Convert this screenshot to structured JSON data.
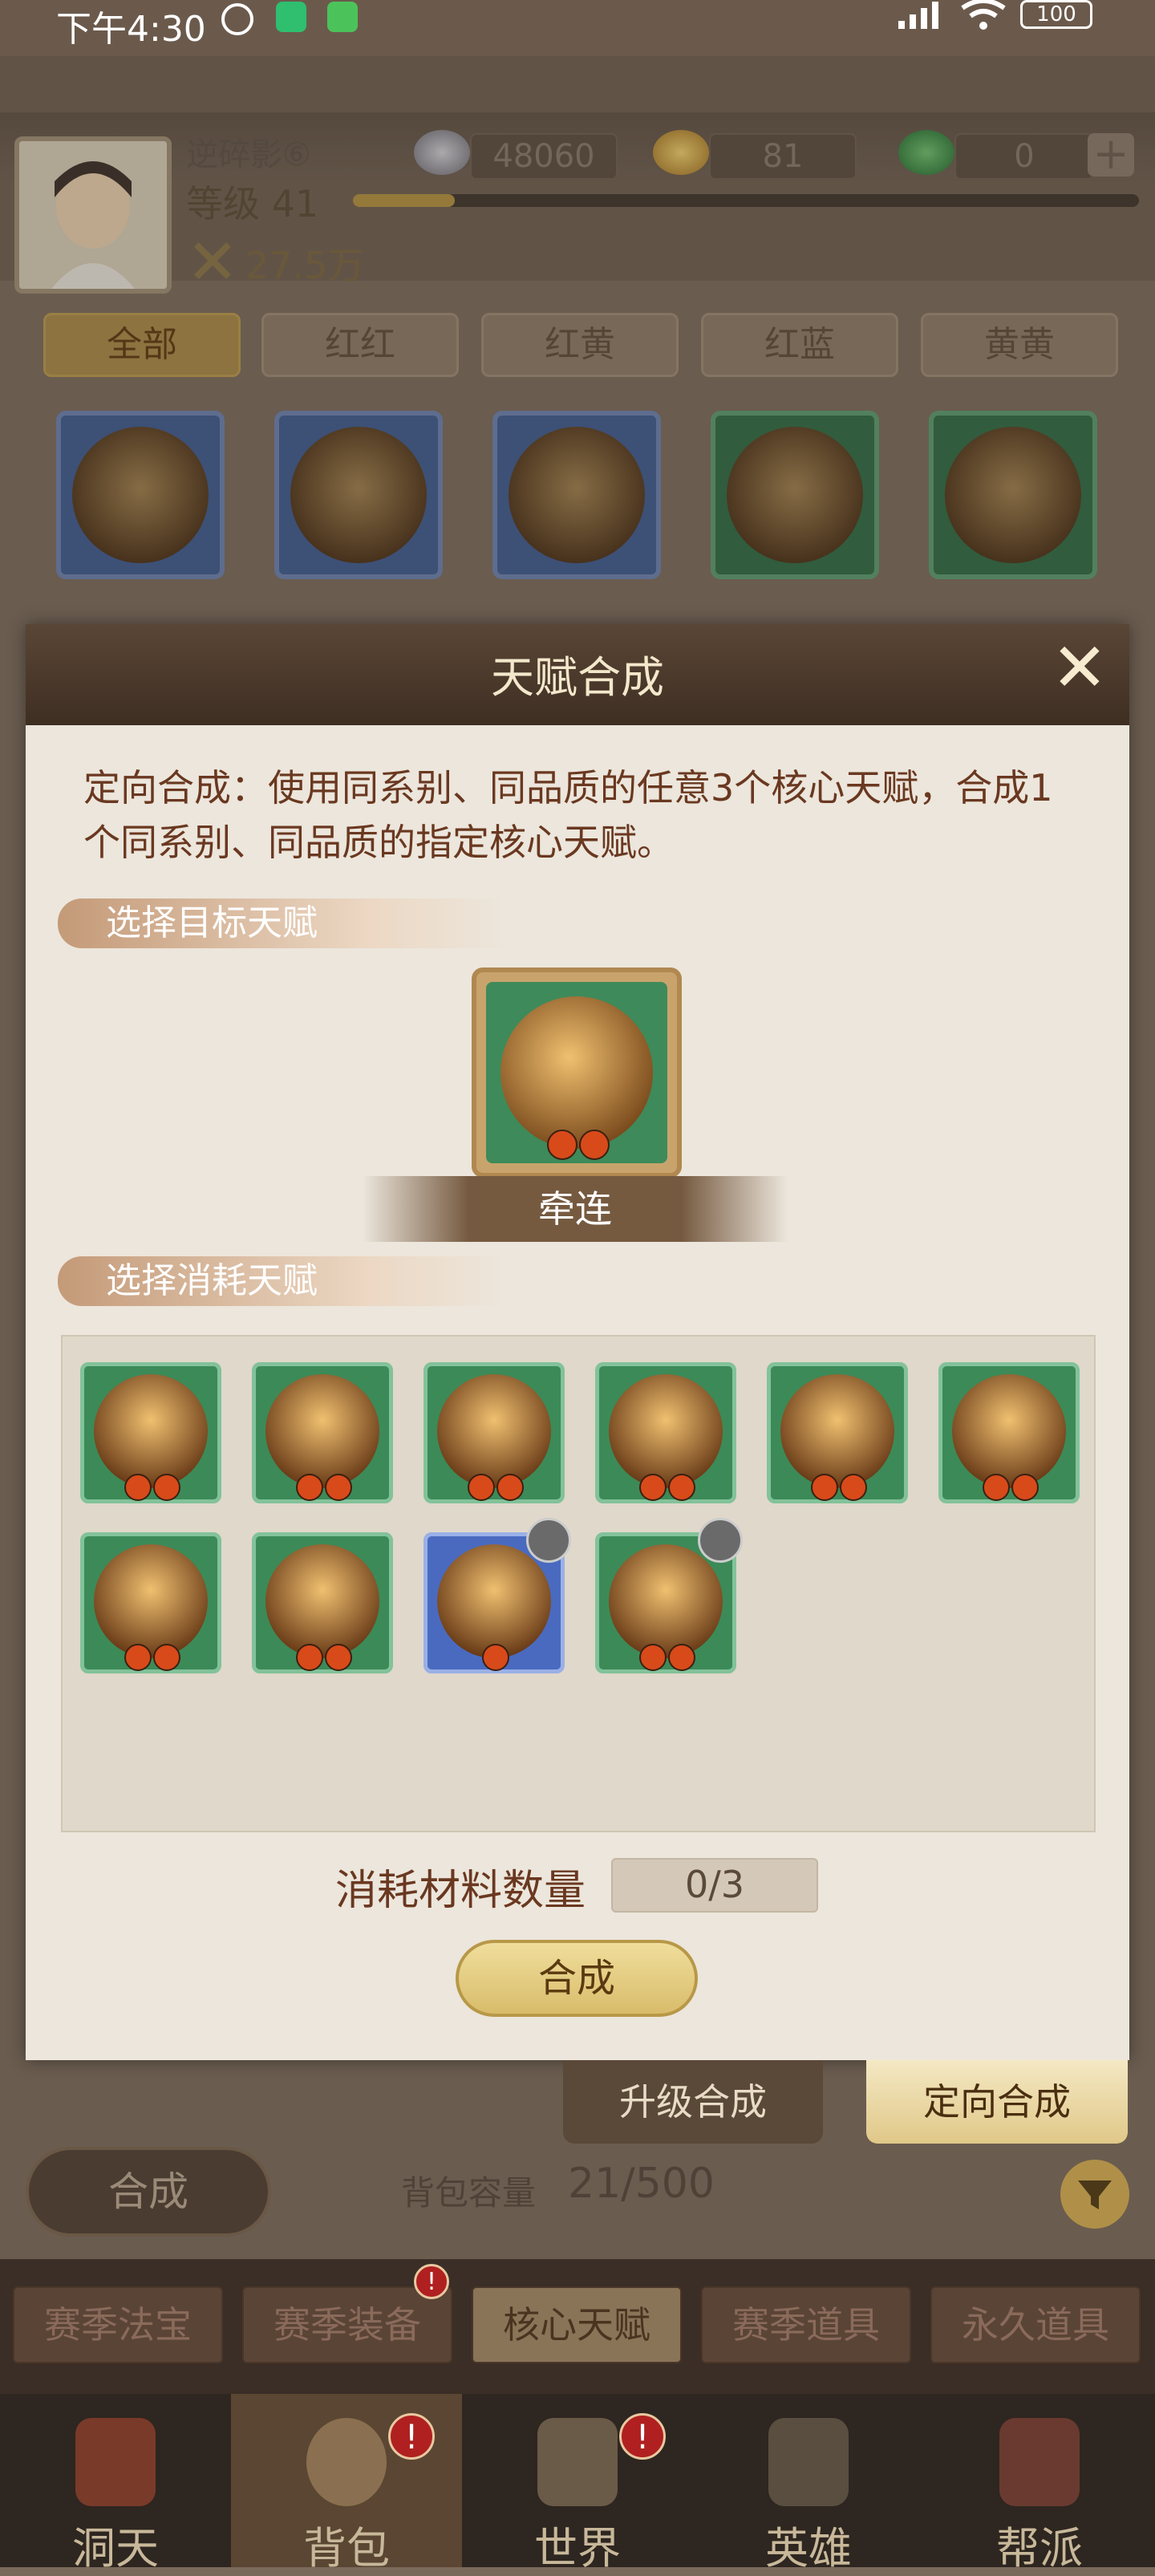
{
  "status_bar": {
    "time": "下午4:30",
    "battery": "100"
  },
  "player": {
    "name": "逆碎影⑥",
    "level": "等级 41",
    "power": "27.5万",
    "xp_fraction": 0.13
  },
  "currencies": [
    {
      "value": "48060"
    },
    {
      "value": "81"
    },
    {
      "value": "0"
    }
  ],
  "plus_label": "+",
  "filter_tabs": [
    "全部",
    "红红",
    "红黄",
    "红蓝",
    "黄黄"
  ],
  "modal": {
    "title": "天赋合成",
    "close": "✕",
    "description": "定向合成：使用同系别、同品质的任意3个核心天赋，合成1个同系别、同品质的指定核心天赋。",
    "section_target": "选择目标天赋",
    "target_name": "牵连",
    "section_consume": "选择消耗天赋",
    "qty_label": "消耗材料数量",
    "qty_value": "0/3",
    "combine_label": "合成"
  },
  "mode_tabs": {
    "upgrade": "升级合成",
    "directed": "定向合成"
  },
  "bag": {
    "combine_button": "合成",
    "capacity_label": "背包容量",
    "capacity_value": "21/500"
  },
  "category_tabs": [
    "赛季法宝",
    "赛季装备",
    "核心天赋",
    "赛季道具",
    "永久道具"
  ],
  "bottom_nav": [
    "洞天",
    "背包",
    "世界",
    "英雄",
    "帮派"
  ],
  "alert_mark": "!"
}
